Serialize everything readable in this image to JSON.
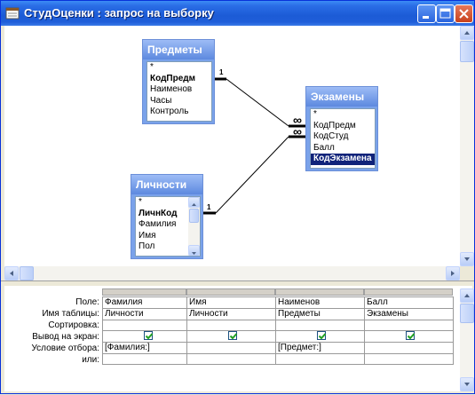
{
  "window": {
    "title": "СтудОценки : запрос на выборку",
    "minimize_icon": "minimize-icon",
    "maximize_icon": "maximize-icon",
    "close_icon": "close-icon"
  },
  "tables": {
    "predmety": {
      "title": "Предметы",
      "fields": [
        "*",
        "КодПредм",
        "Наименов",
        "Часы",
        "Контроль"
      ],
      "key_field": "КодПредм"
    },
    "ekzameny": {
      "title": "Экзамены",
      "fields": [
        "*",
        "КодПредм",
        "КодСтуд",
        "Балл",
        "КодЭкзамена"
      ],
      "key_field": "КодЭкзамена"
    },
    "lichnosti": {
      "title": "Личности",
      "fields": [
        "*",
        "ЛичнКод",
        "Фамилия",
        "Имя",
        "Пол"
      ],
      "key_field": "ЛичнКод"
    }
  },
  "relations": {
    "one_label": "1",
    "many_label": "∞"
  },
  "grid": {
    "row_labels": [
      "Поле:",
      "Имя таблицы:",
      "Сортировка:",
      "Вывод на экран:",
      "Условие отбора:",
      "или:"
    ],
    "columns": [
      {
        "field": "Фамилия",
        "table": "Личности",
        "sort": "",
        "show": true,
        "criteria": "[Фамилия:]",
        "or": ""
      },
      {
        "field": "Имя",
        "table": "Личности",
        "sort": "",
        "show": true,
        "criteria": "",
        "or": ""
      },
      {
        "field": "Наименов",
        "table": "Предметы",
        "sort": "",
        "show": true,
        "criteria": "[Предмет:]",
        "or": ""
      },
      {
        "field": "Балл",
        "table": "Экзамены",
        "sort": "",
        "show": true,
        "criteria": "",
        "or": ""
      }
    ]
  },
  "colors": {
    "titlebar": "#1c5bd6",
    "table_header": "#5d89df",
    "selected_field": "#10237a",
    "checkbox_mark": "#21a121"
  }
}
